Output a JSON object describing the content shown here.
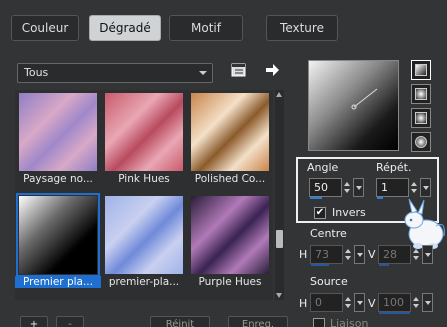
{
  "tabs": [
    {
      "label": "Couleur",
      "active": false
    },
    {
      "label": "Dégradé",
      "active": true
    },
    {
      "label": "Motif",
      "active": false
    },
    {
      "label": "Texture",
      "active": false
    }
  ],
  "category": {
    "selected": "Tous"
  },
  "gradients": [
    {
      "label": "Paysage no...",
      "colors": [
        "#8f7fc3",
        "#d8a8c8",
        "#9f88c9"
      ]
    },
    {
      "label": "Pink Hues",
      "colors": [
        "#c95a6b",
        "#e9a7b4",
        "#b84a5e"
      ]
    },
    {
      "label": "Polished Co...",
      "colors": [
        "#c8844a",
        "#f3e0c8",
        "#8b5a2b"
      ]
    },
    {
      "label": "Premier pla...",
      "colors": [
        "#ffffff",
        "#6e6e6e",
        "#000000"
      ],
      "selected": true
    },
    {
      "label": "premier-pla...",
      "colors": [
        "#9fb3e8",
        "#c9d0f0",
        "#6f8ad9"
      ]
    },
    {
      "label": "Purple Hues",
      "colors": [
        "#2a1d3a",
        "#b17ab8",
        "#3a2352"
      ]
    }
  ],
  "bottom_buttons": {
    "add": "+",
    "remove": "-",
    "reset": "Réinit",
    "save": "Enreg."
  },
  "options": {
    "angle_label": "Angle",
    "angle_value": "50",
    "repeat_label": "Répét.",
    "repeat_value": "1",
    "invert_label": "Invers",
    "invert_checked": true
  },
  "center": {
    "label": "Centre",
    "h_label": "H",
    "h_value": "73",
    "v_label": "V",
    "v_value": "28"
  },
  "source": {
    "label": "Source",
    "h_label": "H",
    "h_value": "0",
    "v_label": "V",
    "v_value": "100"
  },
  "link_label": "Liaison",
  "colors": {
    "accent": "#1e6fd0",
    "panel": "#333435"
  }
}
